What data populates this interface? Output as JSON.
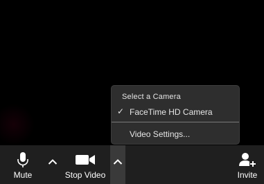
{
  "toolbar": {
    "mute_label": "Mute",
    "stop_video_label": "Stop Video",
    "invite_label": "Invite"
  },
  "camera_menu": {
    "heading": "Select a Camera",
    "selected_camera": "FaceTime HD Camera",
    "check_mark": "✓",
    "video_settings_label": "Video Settings..."
  },
  "icons": {
    "mute": "microphone-icon",
    "video": "video-camera-icon",
    "invite": "add-user-icon",
    "caret": "chevron-up-icon"
  },
  "colors": {
    "background": "#000000",
    "toolbar": "#1f1f1f",
    "menu": "#2e2e2e",
    "active_caret_bg": "#3a3a3a",
    "text": "#ffffff"
  }
}
